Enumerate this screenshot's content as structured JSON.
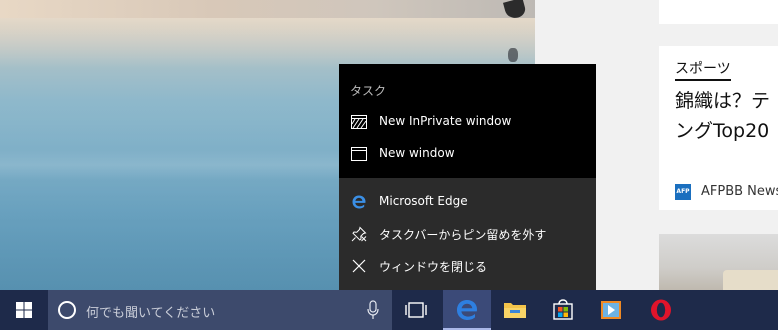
{
  "jumplist": {
    "section_title": "タスク",
    "tasks": [
      {
        "label": "New InPrivate window",
        "icon": "inprivate-icon"
      },
      {
        "label": "New window",
        "icon": "window-icon"
      }
    ],
    "actions": [
      {
        "label": "Microsoft Edge",
        "icon": "edge-icon"
      },
      {
        "label": "タスクバーからピン留めを外す",
        "icon": "unpin-icon"
      },
      {
        "label": "ウィンドウを閉じる",
        "icon": "close-icon"
      }
    ]
  },
  "taskbar": {
    "search_placeholder": "何でも聞いてください",
    "pinned": [
      "task-view-icon",
      "edge-icon",
      "file-explorer-icon",
      "store-icon",
      "media-player-icon",
      "opera-icon"
    ],
    "colors": {
      "bar": "#1e2a4a",
      "search": "#3d4a6c",
      "active": "#3b4a78"
    }
  },
  "news": {
    "category": "スポーツ",
    "headline_line1": "錦織は？テ",
    "headline_line2": "ングTop20",
    "source_logo": "AFP",
    "source_name": "AFPBB News"
  }
}
